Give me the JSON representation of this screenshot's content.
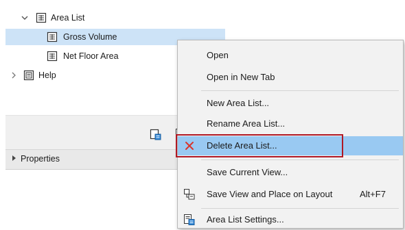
{
  "tree": {
    "items": [
      {
        "label": "Area List",
        "icon": "table-icon",
        "expanded": true
      },
      {
        "label": "Gross Volume",
        "icon": "table-icon",
        "selected": true
      },
      {
        "label": "Net Floor Area",
        "icon": "table-icon"
      },
      {
        "label": "Help",
        "icon": "document-icon",
        "expanded": false
      }
    ]
  },
  "properties": {
    "label": "Properties"
  },
  "context_menu": {
    "items": [
      {
        "label": "Open"
      },
      {
        "label": "Open in New Tab"
      },
      {
        "label": "New Area List..."
      },
      {
        "label": "Rename Area List..."
      },
      {
        "label": "Delete Area List...",
        "icon": "delete-x-icon",
        "highlighted": true
      },
      {
        "label": "Save Current View..."
      },
      {
        "label": "Save View and Place on Layout",
        "shortcut": "Alt+F7",
        "icon": "save-layout-icon"
      },
      {
        "label": "Area List Settings...",
        "icon": "list-settings-icon"
      }
    ]
  },
  "colors": {
    "selection": "#cde3f7",
    "menu_hover": "#99c9f2",
    "highlight_border": "#b01824",
    "delete_x": "#d9342b"
  }
}
